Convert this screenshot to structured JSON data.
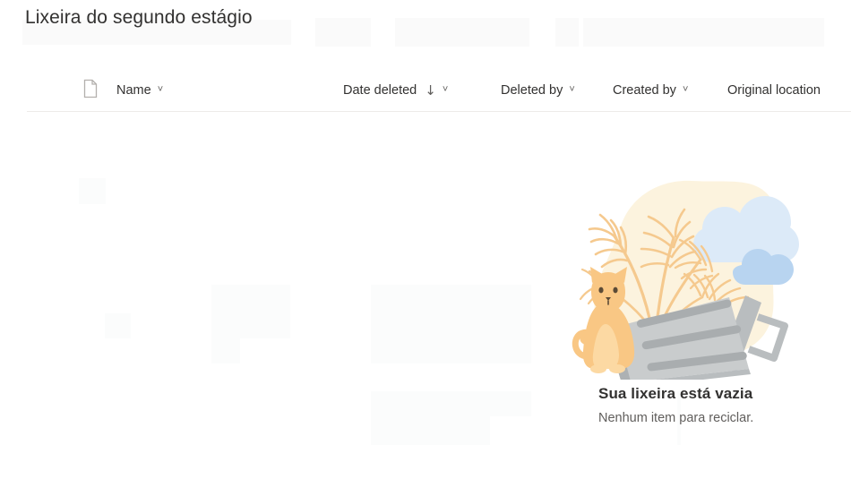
{
  "header": {
    "title": "Lixeira do segundo estágio"
  },
  "columns": {
    "file_icon": "document-icon",
    "items": [
      {
        "label": "Name",
        "chevron": "˅",
        "sorted": false,
        "sort_arrow": ""
      },
      {
        "label": "Date deleted",
        "chevron": "˅",
        "sorted": true,
        "sort_arrow": "↓"
      },
      {
        "label": "Deleted by",
        "chevron": "˅",
        "sorted": false,
        "sort_arrow": ""
      },
      {
        "label": "Created by",
        "chevron": "˅",
        "sorted": false,
        "sort_arrow": ""
      },
      {
        "label": "Original location",
        "chevron": "",
        "sorted": false,
        "sort_arrow": ""
      }
    ]
  },
  "empty_state": {
    "illustration": "empty-recycle-bin-illustration",
    "title": "Sua lixeira está vazia",
    "subtitle": "Nenhum item para reciclar."
  },
  "colors": {
    "text_primary": "#323130",
    "text_secondary": "#605e5c",
    "divider": "#edebe9",
    "placeholder": "#fafafa",
    "blob_cream": "#fcf3de",
    "plant_tan": "#f5c98e",
    "cloud_light": "#dceaf8",
    "cloud_blue": "#b8d4f0",
    "can_body": "#c9cccd",
    "can_band": "#a9adaf",
    "can_dark": "#9b9fa1",
    "cat_body": "#f9c784",
    "cat_light": "#fcd9a3",
    "cat_face": "#5b4a36"
  }
}
